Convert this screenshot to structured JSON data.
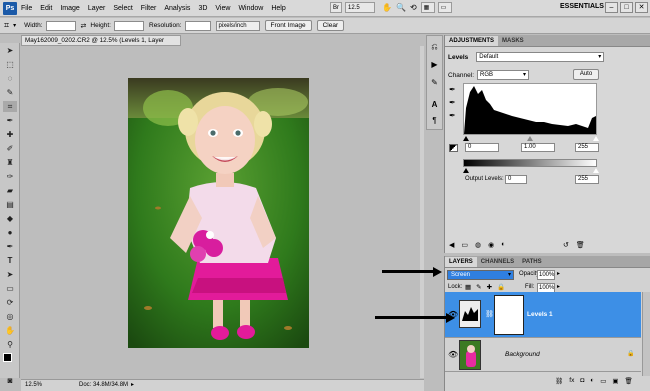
{
  "menubar": {
    "logo": "Ps",
    "items": [
      "File",
      "Edit",
      "Image",
      "Layer",
      "Select",
      "Filter",
      "Analysis",
      "3D",
      "View",
      "Window",
      "Help"
    ],
    "zoom": "12.5",
    "workspace": "ESSENTIALS",
    "window_controls": [
      "–",
      "□",
      "✕"
    ]
  },
  "options": {
    "width_label": "Width:",
    "height_label": "Height:",
    "resolution_label": "Resolution:",
    "resolution_unit": "pixels/inch",
    "front_image": "Front Image",
    "clear": "Clear"
  },
  "document": {
    "tab_title": "May162009_0202.CR2 @ 12.5% (Levels 1, Layer Mask/8) *",
    "zoom": "12.5%",
    "doc_size": "Doc: 34.8M/34.8M"
  },
  "adjustments": {
    "tabs": [
      "ADJUSTMENTS",
      "MASKS"
    ],
    "levels_label": "Levels",
    "preset": "Default",
    "channel_label": "Channel:",
    "channel": "RGB",
    "auto": "Auto",
    "input_black": "0",
    "input_gamma": "1.00",
    "input_white": "255",
    "output_label": "Output Levels:",
    "output_black": "0",
    "output_white": "255"
  },
  "layers": {
    "tabs": [
      "LAYERS",
      "CHANNELS",
      "PATHS"
    ],
    "blend_mode": "Screen",
    "opacity_label": "Opacity:",
    "opacity": "100%",
    "lock_label": "Lock:",
    "fill_label": "Fill:",
    "fill": "100%",
    "items": [
      {
        "name": "Levels 1",
        "selected": true
      },
      {
        "name": "Background",
        "selected": false
      }
    ]
  },
  "colors": {
    "selection": "#3d8fe6",
    "blend_highlight": "#2f7fe0",
    "ps_blue": "#1b5aa8"
  }
}
